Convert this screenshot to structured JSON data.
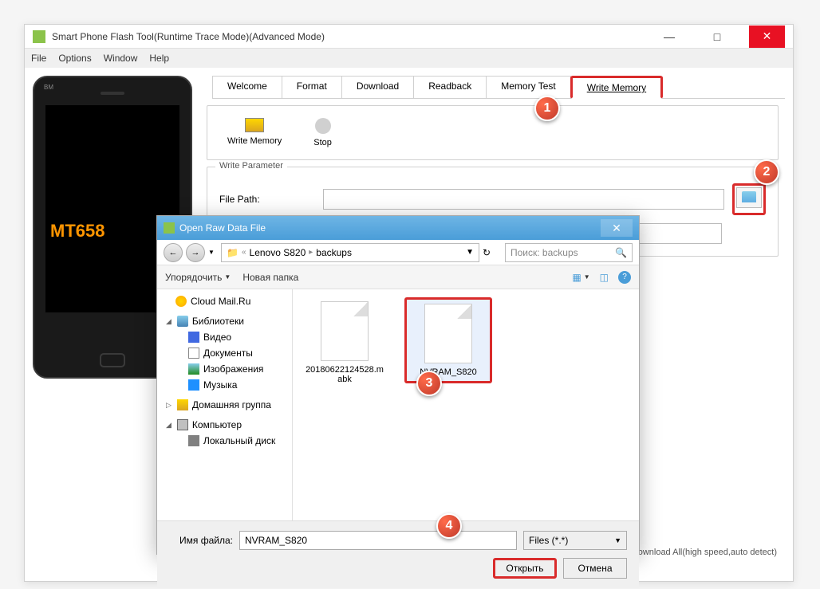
{
  "window": {
    "title": "Smart Phone Flash Tool(Runtime Trace Mode)(Advanced Mode)"
  },
  "menu": {
    "file": "File",
    "options": "Options",
    "window": "Window",
    "help": "Help"
  },
  "phone": {
    "brand": "BM",
    "chip": "MT658"
  },
  "tabs": {
    "welcome": "Welcome",
    "format": "Format",
    "download": "Download",
    "readback": "Readback",
    "memtest": "Memory Test",
    "writemem": "Write Memory"
  },
  "toolbar": {
    "write_memory": "Write Memory",
    "stop": "Stop"
  },
  "params": {
    "group_label": "Write Parameter",
    "file_path_label": "File Path:",
    "file_path_value": ""
  },
  "status": "ownload All(high speed,auto detect)",
  "dialog": {
    "title": "Open Raw Data File",
    "breadcrumb": {
      "b1": "Lenovo S820",
      "b2": "backups"
    },
    "search_placeholder": "Поиск: backups",
    "organize": "Упорядочить",
    "new_folder": "Новая папка",
    "sidebar": {
      "cloud": "Cloud Mail.Ru",
      "libraries": "Библиотеки",
      "video": "Видео",
      "documents": "Документы",
      "images": "Изображения",
      "music": "Музыка",
      "homegroup": "Домашняя группа",
      "computer": "Компьютер",
      "localdisk": "Локальный диск"
    },
    "files": {
      "f1": "20180622124528.mabk",
      "f2": "NVRAM_S820"
    },
    "filename_label": "Имя файла:",
    "filename_value": "NVRAM_S820",
    "filter": "Files (*.*)",
    "open_btn": "Открыть",
    "cancel_btn": "Отмена"
  },
  "callouts": {
    "c1": "1",
    "c2": "2",
    "c3": "3",
    "c4": "4"
  }
}
